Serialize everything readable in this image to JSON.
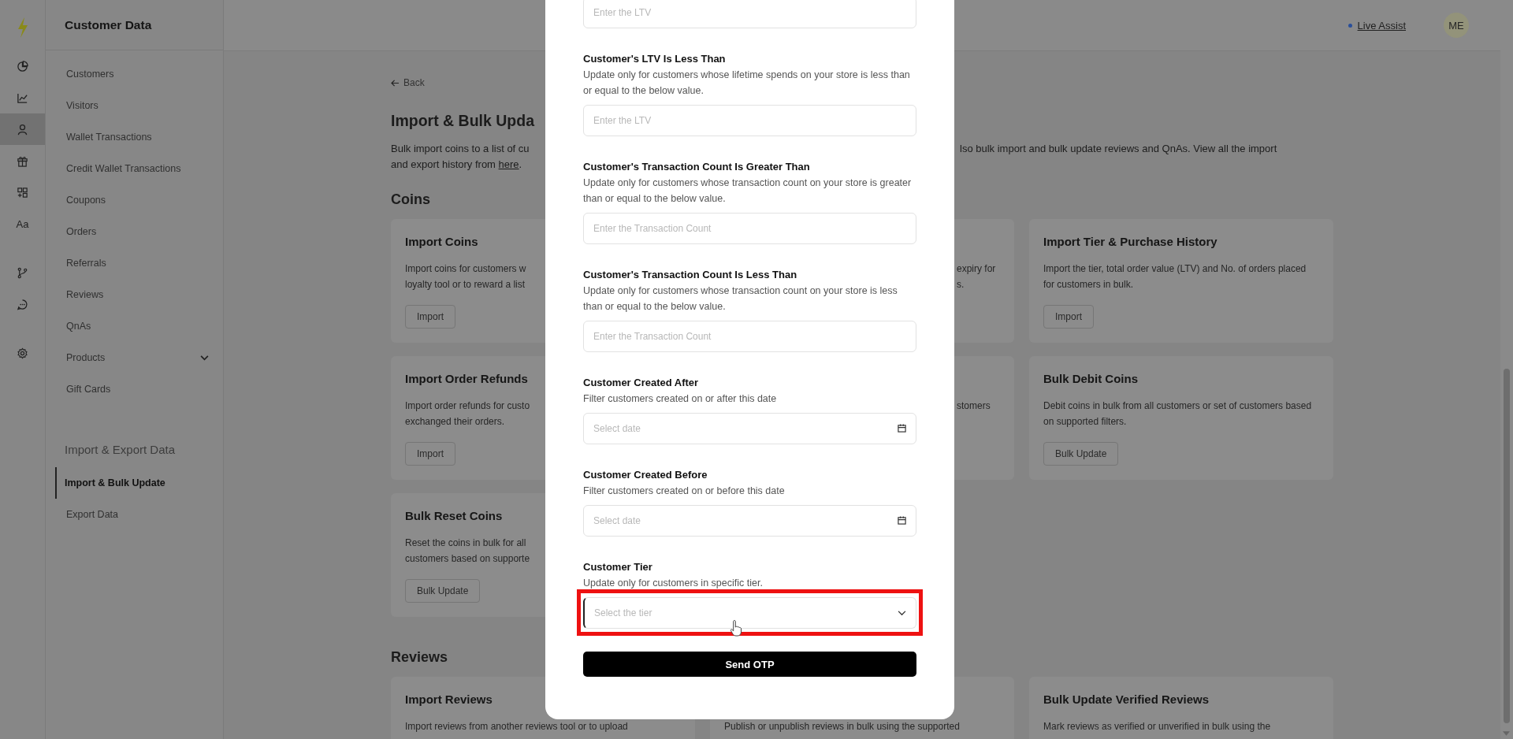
{
  "rail": {
    "groups": [
      [
        {
          "selected": false
        },
        {
          "selected": false
        },
        {
          "selected": true
        },
        {
          "selected": false
        },
        {
          "selected": false
        },
        {
          "label": "Aa",
          "selected": false
        }
      ],
      [
        {
          "selected": false
        },
        {
          "selected": false
        }
      ],
      [
        {
          "selected": false
        }
      ]
    ]
  },
  "sidebar": {
    "title": "Customer Data",
    "sections": [
      {
        "items": [
          {
            "label": "Customers",
            "kind": "link",
            "selected": false
          },
          {
            "label": "Visitors",
            "kind": "link",
            "selected": false
          },
          {
            "label": "Wallet Transactions",
            "kind": "link",
            "selected": false
          },
          {
            "label": "Credit Wallet Transactions",
            "kind": "link",
            "selected": false
          },
          {
            "label": "Coupons",
            "kind": "link",
            "selected": false
          },
          {
            "label": "Orders",
            "kind": "link",
            "selected": false
          },
          {
            "label": "Referrals",
            "kind": "link",
            "selected": false
          },
          {
            "label": "Reviews",
            "kind": "link",
            "selected": false
          },
          {
            "label": "QnAs",
            "kind": "link",
            "selected": false
          },
          {
            "label": "Products",
            "kind": "group",
            "selected": false
          },
          {
            "label": "Gift Cards",
            "kind": "link",
            "selected": false
          }
        ]
      },
      {
        "heading": "Import & Export Data",
        "items": [
          {
            "label": "Import & Bulk Update",
            "kind": "link",
            "selected": true
          },
          {
            "label": "Export Data",
            "kind": "link",
            "selected": false
          }
        ]
      }
    ]
  },
  "topbar": {
    "live_assist": "Live Assist",
    "avatar": "ME"
  },
  "page": {
    "back": "Back",
    "title": "Import & Bulk Upda",
    "intro_fragments": [
      "Bulk import coins to a list of cu",
      "lso bulk import and bulk update reviews and QnAs. View all the import"
    ],
    "intro_line2": {
      "before": "and export history from ",
      "link": "here",
      "after": "."
    },
    "sections": [
      {
        "heading": "Coins",
        "rows": [
          [
            {
              "kind": "full",
              "title": "Import Coins",
              "lines": [
                "Import coins for customers w",
                "loyalty tool or to reward a list"
              ],
              "button": "Import"
            },
            {
              "kind": "covered",
              "lines": [
                "expiry for",
                "s."
              ]
            },
            {
              "kind": "full",
              "title": "Import Tier & Purchase History",
              "description": "Import the tier, total order value (LTV) and No. of orders placed for customers in bulk.",
              "button": "Import"
            }
          ],
          [
            {
              "kind": "full",
              "title": "Import Order Refunds",
              "lines": [
                "Import order refunds for custo",
                "exchanged their orders."
              ],
              "button": "Import"
            },
            {
              "kind": "covered",
              "lines": [
                "stomers"
              ]
            },
            {
              "kind": "full",
              "title": "Bulk Debit Coins",
              "description": "Debit coins in bulk from all customers or set of customers based on supported filters.",
              "button": "Bulk Update"
            }
          ],
          [
            {
              "kind": "full",
              "title": "Bulk Reset Coins",
              "lines": [
                "Reset the coins in bulk for all",
                "customers based on supporte"
              ],
              "button": "Bulk Update"
            }
          ]
        ]
      },
      {
        "heading": "Reviews",
        "rows": [
          [
            {
              "kind": "full",
              "title": "Import Reviews",
              "lines": [
                "Import reviews from another reviews tool or to upload"
              ]
            },
            {
              "kind": "full",
              "lines": [
                "Publish or unpublish reviews in bulk using the supported"
              ]
            },
            {
              "kind": "full",
              "title": "Bulk Update Verified Reviews",
              "lines": [
                "Mark reviews as verified or unverified in bulk using the"
              ]
            }
          ]
        ]
      }
    ]
  },
  "modal": {
    "fields": [
      {
        "kind": "text",
        "placeholder": "Enter the LTV"
      },
      {
        "kind": "text",
        "label": "Customer's LTV Is Less Than",
        "description": "Update only for customers whose lifetime spends on your store is less than or equal to the below value.",
        "placeholder": "Enter the LTV"
      },
      {
        "kind": "text",
        "label": "Customer's Transaction Count Is Greater Than",
        "description": "Update only for customers whose transaction count on your store is greater than or equal to the below value.",
        "placeholder": "Enter the Transaction Count"
      },
      {
        "kind": "text",
        "label": "Customer's Transaction Count Is Less Than",
        "description": "Update only for customers whose transaction count on your store is less than or equal to the below value.",
        "placeholder": "Enter the Transaction Count"
      },
      {
        "kind": "date",
        "label": "Customer Created After",
        "description": "Filter customers created on or after this date",
        "placeholder": "Select date"
      },
      {
        "kind": "date",
        "label": "Customer Created Before",
        "description": "Filter customers created on or before this date",
        "placeholder": "Select date"
      },
      {
        "kind": "select",
        "label": "Customer Tier",
        "description": "Update only for customers in specific tier.",
        "placeholder": "Select the tier",
        "highlighted": true
      }
    ],
    "submit": "Send OTP"
  }
}
